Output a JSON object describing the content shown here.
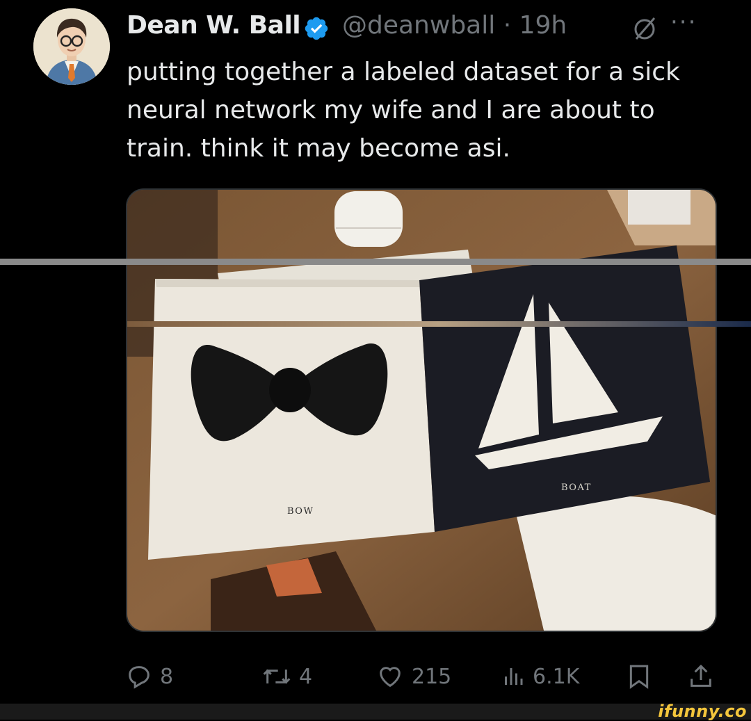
{
  "tweet": {
    "author_name": "Dean W. Ball",
    "handle": "@deanwball",
    "separator": "·",
    "time": "19h",
    "more": "···",
    "text": "putting together a labeled dataset for a sick neural network my wife and I are about to train. think it may become asi."
  },
  "media": {
    "left_card_label": "BOW",
    "right_card_label": "BOAT"
  },
  "actions": {
    "replies": "8",
    "reposts": "4",
    "likes": "215",
    "views": "6.1K"
  },
  "watermark": "ifunny.co",
  "colors": {
    "background": "#000000",
    "text": "#e7e9ea",
    "muted": "#71767b",
    "verified": "#1d9bf0",
    "watermark": "#f4c63c"
  },
  "icons": [
    "verified-badge-icon",
    "grok-icon",
    "more-icon",
    "reply-icon",
    "repost-icon",
    "like-icon",
    "views-icon",
    "bookmark-icon",
    "share-icon"
  ]
}
